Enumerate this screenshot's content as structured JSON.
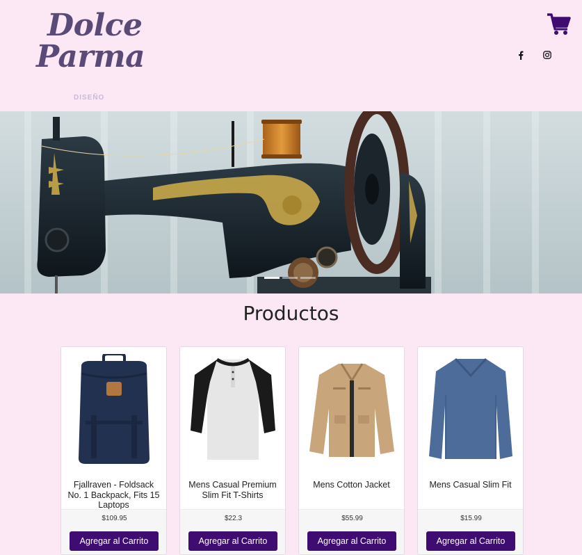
{
  "brand": {
    "line1": "Dolce",
    "line2": "Parma",
    "color": "#5a4a78"
  },
  "nav": {
    "item": "DISEÑO"
  },
  "header_icons": {
    "cart": "cart-icon",
    "facebook": "facebook-icon",
    "instagram": "instagram-icon"
  },
  "carousel": {
    "slides": 3,
    "active_index": 0
  },
  "products_section": {
    "title": "Productos"
  },
  "products": [
    {
      "title": "Fjallraven - Foldsack No. 1 Backpack, Fits 15 Laptops",
      "price": "$109.95",
      "button": "Agregar al Carrito"
    },
    {
      "title": "Mens Casual Premium Slim Fit T-Shirts",
      "price": "$22.3",
      "button": "Agregar al Carrito"
    },
    {
      "title": "Mens Cotton Jacket",
      "price": "$55.99",
      "button": "Agregar al Carrito"
    },
    {
      "title": "Mens Casual Slim Fit",
      "price": "$15.99",
      "button": "Agregar al Carrito"
    }
  ],
  "colors": {
    "background": "#fce8f5",
    "button": "#3f0c72",
    "cart": "#3f0c72"
  }
}
